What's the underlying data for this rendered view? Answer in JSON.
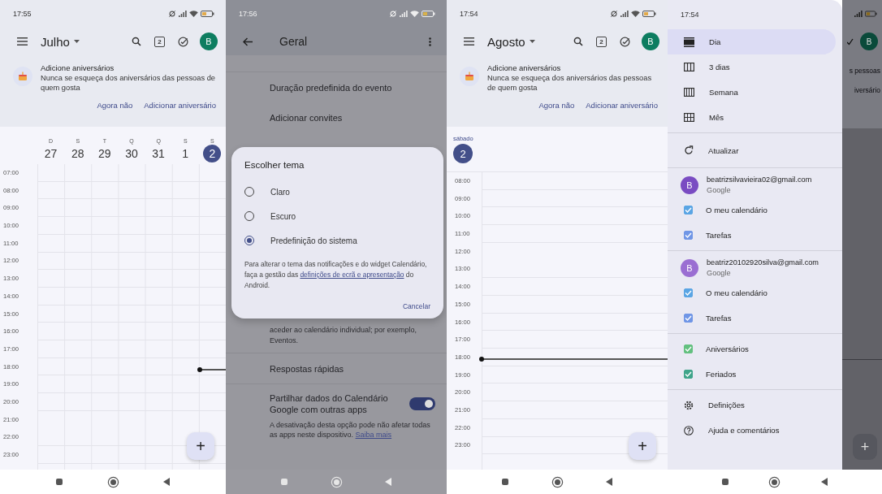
{
  "week_view": {
    "status_time": "17:55",
    "month": "Julho",
    "today_badge": "2",
    "avatar": "B",
    "banner": {
      "title": "Adicione aniversários",
      "text": "Nunca se esqueça dos aniversários das pessoas de quem gosta",
      "actions": [
        "Agora não",
        "Adicionar aniversário"
      ]
    },
    "days": [
      {
        "weekday": "D",
        "date": "27",
        "selected": false
      },
      {
        "weekday": "S",
        "date": "28",
        "selected": false
      },
      {
        "weekday": "T",
        "date": "29",
        "selected": false
      },
      {
        "weekday": "Q",
        "date": "30",
        "selected": false
      },
      {
        "weekday": "Q",
        "date": "31",
        "selected": false
      },
      {
        "weekday": "S",
        "date": "1",
        "selected": false
      },
      {
        "weekday": "S",
        "date": "2",
        "selected": true
      }
    ],
    "hours": [
      "07:00",
      "08:00",
      "09:00",
      "10:00",
      "11:00",
      "12:00",
      "13:00",
      "14:00",
      "15:00",
      "16:00",
      "17:00",
      "18:00",
      "19:00",
      "20:00",
      "21:00",
      "22:00",
      "23:00"
    ],
    "fab": "+"
  },
  "settings_view": {
    "status_time": "17:56",
    "title": "Geral",
    "items": [
      {
        "kind": "item",
        "label": "Duração predefinida do evento"
      },
      {
        "kind": "item",
        "label": "Adicionar convites"
      }
    ],
    "dialog": {
      "title": "Escolher tema",
      "options": [
        {
          "label": "Claro",
          "selected": false
        },
        {
          "label": "Escuro",
          "selected": false
        },
        {
          "label": "Predefinição do sistema",
          "selected": true
        }
      ],
      "note_before": "Para alterar o tema das notificações e do widget Calendário, faça a gestão das",
      "note_link": "definições de ecrã e apresentação",
      "note_after": "do Android.",
      "cancel": "Cancelar"
    },
    "lower_items": [
      {
        "kind": "text",
        "label": "aceder ao calendário individual; por exemplo, Eventos."
      },
      {
        "kind": "item",
        "label": "Respostas rápidas"
      },
      {
        "kind": "toggle",
        "label": "Partilhar dados do Calendário Google com outras apps",
        "on": true,
        "note": "A desativação desta opção pode não afetar todas as apps neste dispositivo.",
        "link": "Saiba mais"
      }
    ]
  },
  "day_view": {
    "status_time": "17:54",
    "month": "Agosto",
    "today_badge": "2",
    "avatar": "B",
    "banner": {
      "title": "Adicione aniversários",
      "text": "Nunca se esqueça dos aniversários das pessoas de quem gosta",
      "actions": [
        "Agora não",
        "Adicionar aniversário"
      ]
    },
    "weekday": "sábado",
    "date": "2",
    "hours": [
      "08:00",
      "09:00",
      "10:00",
      "11:00",
      "12:00",
      "13:00",
      "14:00",
      "15:00",
      "16:00",
      "17:00",
      "18:00",
      "19:00",
      "20:00",
      "21:00",
      "22:00",
      "23:00"
    ],
    "fab": "+"
  },
  "drawer_view": {
    "status_time": "17:54",
    "views": [
      {
        "kind": "day",
        "label": "Dia",
        "selected": true
      },
      {
        "kind": "three_days",
        "label": "3 dias",
        "selected": false
      },
      {
        "kind": "week",
        "label": "Semana",
        "selected": false
      },
      {
        "kind": "month",
        "label": "Mês",
        "selected": false
      }
    ],
    "refresh": "Atualizar",
    "accounts": [
      {
        "email": "beatrizsilvavieira02@gmail.com",
        "provider": "Google",
        "avatar": "B",
        "color": "#7a4cc2",
        "calendars": [
          {
            "label": "O meu calendário",
            "checked": true,
            "color": "#5aa5e4"
          },
          {
            "label": "Tarefas",
            "checked": true,
            "color": "#7096e6"
          }
        ]
      },
      {
        "email": "beatriz20102920silva@gmail.com",
        "provider": "Google",
        "avatar": "B",
        "color": "#9a6ed2",
        "calendars": [
          {
            "label": "O meu calendário",
            "checked": true,
            "color": "#5aa5e4"
          },
          {
            "label": "Tarefas",
            "checked": true,
            "color": "#7096e6"
          }
        ]
      }
    ],
    "other_calendars": [
      {
        "label": "Aniversários",
        "checked": true,
        "color": "#63c07f"
      },
      {
        "label": "Feriados",
        "checked": true,
        "color": "#3fa48a"
      }
    ],
    "footer": [
      {
        "kind": "settings",
        "label": "Definições"
      },
      {
        "kind": "help",
        "label": "Ajuda e comentários"
      }
    ],
    "background": {
      "avatar": "B",
      "texts": [
        "s pessoas",
        "iversário"
      ],
      "fab": "+"
    }
  }
}
